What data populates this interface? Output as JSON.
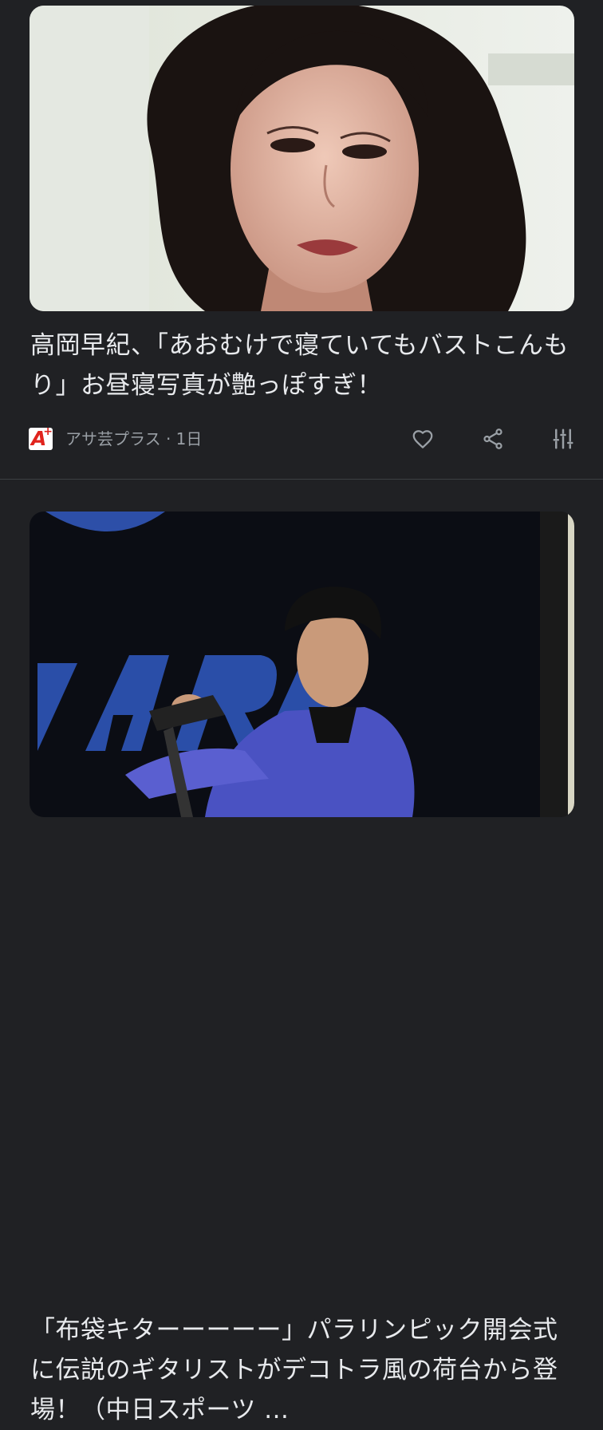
{
  "feed": {
    "articles": [
      {
        "headline": "高岡早紀、「あおむけで寝ていてもバストこんもり」お昼寝写真が艶っぽすぎ！",
        "source": "アサ芸プラス",
        "age": "1日",
        "source_line": "アサ芸プラス · 1日",
        "source_logo_icon": "asagei-plus-logo",
        "actions": [
          "heart-icon",
          "share-icon",
          "more-options-icon"
        ]
      },
      {
        "headline": "「布袋キターーーーー」パラリンピック開会式に伝説のギタリストがデコトラ風の荷台から登場！（中日スポーツ ..."
      }
    ]
  },
  "colors": {
    "background": "#202124",
    "headline": "#e8eaed",
    "meta": "#9aa0a6",
    "icon": "#9aa0a6",
    "logo_red": "#e0231d"
  }
}
